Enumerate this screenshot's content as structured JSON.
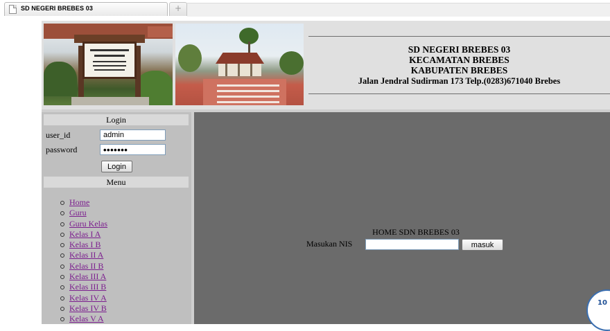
{
  "browser": {
    "tab_title": "SD NEGERI BREBES 03",
    "new_tab_symbol": "+"
  },
  "header": {
    "line1": "SD NEGERI BREBES 03",
    "line2": "KECAMATAN BREBES",
    "line3": "KABUPATEN BREBES",
    "address": "Jalan Jendral Sudirman 173 Telp.(0283)671040 Brebes"
  },
  "login": {
    "heading": "Login",
    "user_label": "user_id",
    "user_value": "admin",
    "password_label": "password",
    "password_value": "•••••••",
    "button": "Login"
  },
  "menu": {
    "heading": "Menu",
    "items": [
      "Home",
      "Guru",
      "Guru Kelas",
      "Kelas I A",
      "Kelas I B",
      "Kelas II A",
      "Kelas II B",
      "Kelas III A",
      "Kelas III B",
      "Kelas IV A",
      "Kelas IV B",
      "Kelas V A"
    ]
  },
  "main": {
    "title": "HOME SDN BREBES 03",
    "nis_label": "Masukan NIS",
    "nis_value": "",
    "submit": "masuk"
  },
  "badge": {
    "text": "10"
  },
  "colors": {
    "sidebar_bg": "#bfbfbf",
    "main_bg": "#6b6b6b",
    "link": "#7b1d8e",
    "header_bg": "#e0e0e0"
  }
}
